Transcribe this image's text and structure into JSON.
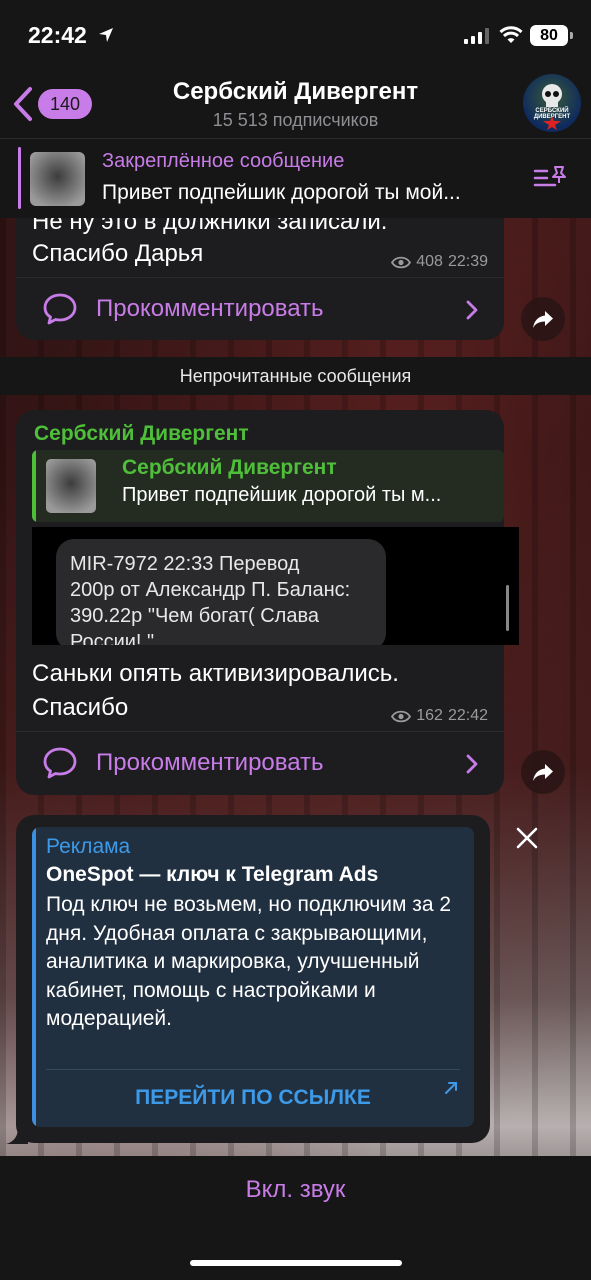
{
  "status_bar": {
    "time": "22:42",
    "battery": "80"
  },
  "header": {
    "back_count": "140",
    "title": "Сербский Дивергент",
    "subscribers": "15 513 подписчиков",
    "avatar_text": "СЕРБСКИЙ ДИВЕРГЕНТ"
  },
  "pinned": {
    "title": "Закреплённое сообщение",
    "text": "Привет подпейшик дорогой ты мой..."
  },
  "message1": {
    "line1": "Не ну это в должники записали.",
    "line2": "Спасибо Дарья",
    "views": "408",
    "time": "22:39",
    "comment_label": "Прокомментировать"
  },
  "unread_separator": "Непрочитанные сообщения",
  "message2": {
    "sender": "Сербский Дивергент",
    "forward_title": "Сербский Дивергент",
    "forward_text": "Привет подпейшик дорогой ты м...",
    "sms_line1": "MIR-7972 22:33 Перевод",
    "sms_line2": "200р от Александр П. Баланс:",
    "sms_line3": "390.22р \"Чем богат( Слава",
    "sms_line4": "России! \"",
    "line1": "Саньки опять активизировались.",
    "line2": "Спасибо",
    "views": "162",
    "time": "22:42",
    "comment_label": "Прокомментировать"
  },
  "ad": {
    "label": "Реклама",
    "title": "OneSpot — ключ к Telegram Ads",
    "text": "Под ключ не возьмем, но подключим за 2 дня. Удобная оплата с закрывающими, аналитика и маркировка, улучшенный кабинет, помощь с настройками и модерацией.",
    "button": "ПЕРЕЙТИ ПО ССЫЛКЕ"
  },
  "bottom": {
    "sound_button": "Вкл. звук"
  },
  "colors": {
    "accent": "#c87ce8",
    "sender_green": "#4fbf3a",
    "ad_blue": "#3d9ae8"
  }
}
